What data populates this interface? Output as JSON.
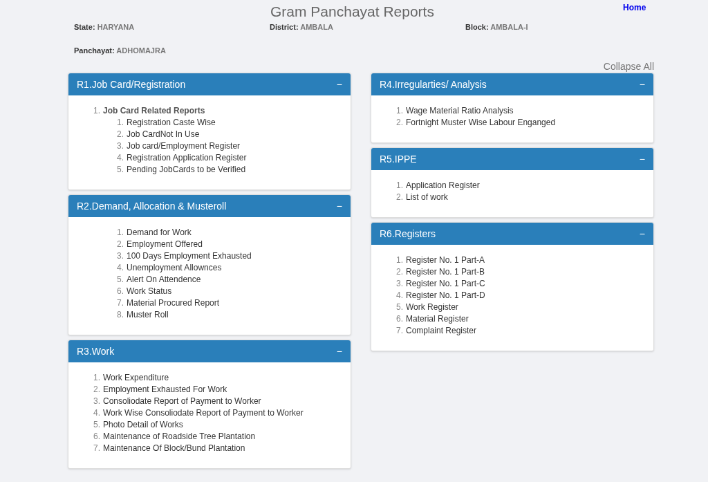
{
  "header": {
    "title": "Gram Panchayat Reports",
    "home_link": "Home"
  },
  "info": [
    {
      "label": "State:",
      "value": "HARYANA"
    },
    {
      "label": "District:",
      "value": "AMBALA"
    },
    {
      "label": "Block:",
      "value": "AMBALA-I"
    },
    {
      "label": "Panchayat:",
      "value": "ADHOMAJRA"
    }
  ],
  "collapse_all": "Collapse All",
  "columns": [
    {
      "panels": [
        {
          "title": "R1.Job Card/Registration",
          "toggle": "−",
          "expanded": true,
          "items": [
            {
              "number": "1.",
              "label": "Job Card Related Reports",
              "children": [
                {
                  "number": "1.",
                  "label": "Registration Caste Wise"
                },
                {
                  "number": "2.",
                  "label": "Job CardNot In Use"
                },
                {
                  "number": "3.",
                  "label": "Job card/Employment Register"
                },
                {
                  "number": "4.",
                  "label": "Registration Application Register"
                },
                {
                  "number": "5.",
                  "label": "Pending JobCards to be Verified"
                }
              ]
            }
          ]
        },
        {
          "title": "R2.Demand, Allocation & Musteroll",
          "toggle": "−",
          "expanded": true,
          "items": [
            {
              "children": [
                {
                  "number": "1.",
                  "label": "Demand for Work"
                },
                {
                  "number": "2.",
                  "label": "Employment Offered"
                },
                {
                  "number": "3.",
                  "label": "100 Days Employment Exhausted"
                },
                {
                  "number": "4.",
                  "label": "Unemployment Allownces"
                },
                {
                  "number": "5.",
                  "label": "Alert On Attendence"
                },
                {
                  "number": "6.",
                  "label": "Work Status"
                },
                {
                  "number": "7.",
                  "label": "Material Procured Report"
                },
                {
                  "number": "8.",
                  "label": "Muster Roll"
                }
              ]
            }
          ]
        },
        {
          "title": "R3.Work",
          "toggle": "−",
          "expanded": true,
          "items": [
            {
              "number": "1.",
              "label": "Work Expenditure"
            },
            {
              "number": "2.",
              "label": "Employment Exhausted For Work"
            },
            {
              "number": "3.",
              "label": "Consoliodate Report of Payment to Worker"
            },
            {
              "number": "4.",
              "label": "Work Wise Consoliodate Report of Payment to Worker"
            },
            {
              "number": "5.",
              "label": "Photo Detail of Works"
            },
            {
              "number": "6.",
              "label": "Maintenance of Roadside Tree Plantation"
            },
            {
              "number": "7.",
              "label": "Maintenance Of Block/Bund Plantation"
            }
          ]
        }
      ]
    },
    {
      "panels": [
        {
          "title": "R4.Irregularties/ Analysis",
          "toggle": "−",
          "expanded": true,
          "items": [
            {
              "number": "1.",
              "label": "Wage Material Ratio Analysis"
            },
            {
              "number": "2.",
              "label": "Fortnight Muster Wise Labour Enganged"
            }
          ]
        },
        {
          "title": "R5.IPPE",
          "toggle": "−",
          "expanded": true,
          "items": [
            {
              "number": "1.",
              "label": "Application Register"
            },
            {
              "number": "2.",
              "label": "List of work"
            }
          ]
        },
        {
          "title": "R6.Registers",
          "toggle": "−",
          "expanded": true,
          "items": [
            {
              "number": "1.",
              "label": "Register No. 1 Part-A"
            },
            {
              "number": "2.",
              "label": "Register No. 1 Part-B"
            },
            {
              "number": "3.",
              "label": "Register No. 1 Part-C"
            },
            {
              "number": "4.",
              "label": "Register No. 1 Part-D"
            },
            {
              "number": "5.",
              "label": "Work Register"
            },
            {
              "number": "6.",
              "label": "Material Register"
            },
            {
              "number": "7.",
              "label": "Complaint Register"
            }
          ]
        }
      ]
    }
  ]
}
